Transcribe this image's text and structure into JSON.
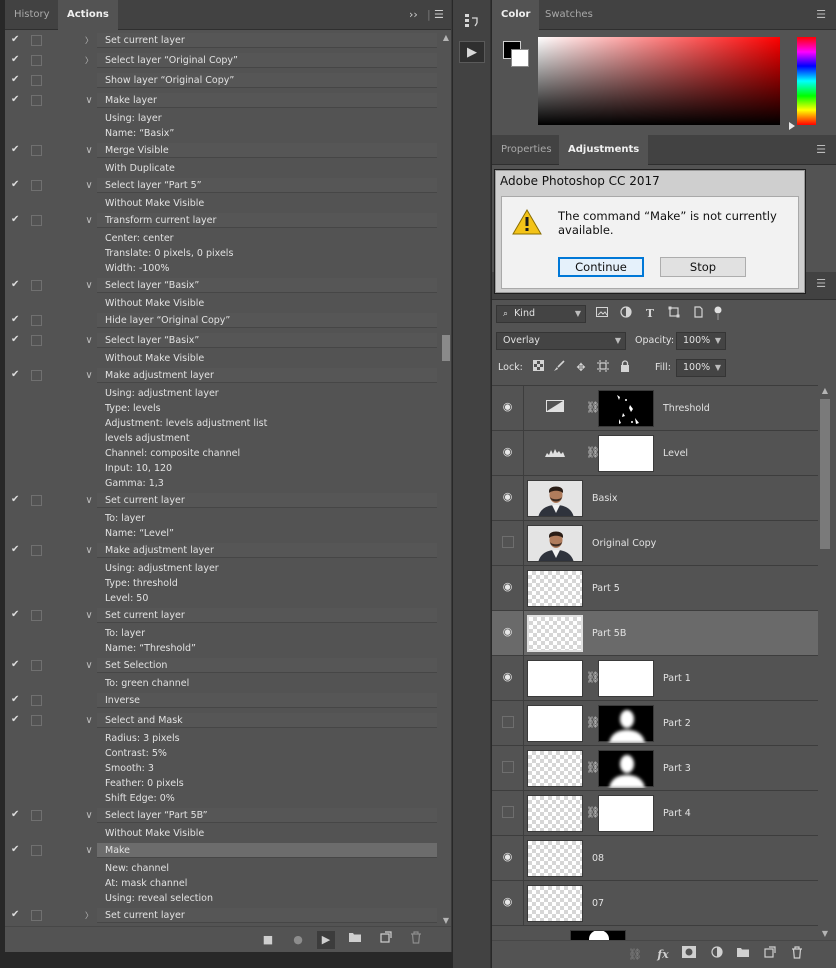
{
  "actions_panel": {
    "tabs": [
      "History",
      "Actions"
    ],
    "active_tab": "Actions",
    "rows": [
      {
        "check": true,
        "twist": "closed",
        "text": "Set current layer",
        "head": true
      },
      {
        "check": true,
        "twist": "closed",
        "text": "Select layer “Original Copy”",
        "head": true
      },
      {
        "check": true,
        "twist": "",
        "text": "Show layer “Original Copy”",
        "head": true
      },
      {
        "check": true,
        "twist": "open",
        "text": "Make layer",
        "head": true
      },
      {
        "check": false,
        "twist": "",
        "text": "Using: layer",
        "head": false
      },
      {
        "check": false,
        "twist": "",
        "text": "Name:  “Basix”",
        "head": false
      },
      {
        "check": true,
        "twist": "open",
        "text": "Merge Visible",
        "head": true
      },
      {
        "check": false,
        "twist": "",
        "text": "With Duplicate",
        "head": false
      },
      {
        "check": true,
        "twist": "open",
        "text": "Select layer “Part 5”",
        "head": true
      },
      {
        "check": false,
        "twist": "",
        "text": "Without Make Visible",
        "head": false
      },
      {
        "check": true,
        "twist": "open",
        "text": "Transform current layer",
        "head": true
      },
      {
        "check": false,
        "twist": "",
        "text": "Center: center",
        "head": false
      },
      {
        "check": false,
        "twist": "",
        "text": "Translate: 0 pixels, 0 pixels",
        "head": false
      },
      {
        "check": false,
        "twist": "",
        "text": "Width: -100%",
        "head": false
      },
      {
        "check": true,
        "twist": "open",
        "text": "Select layer “Basix”",
        "head": true
      },
      {
        "check": false,
        "twist": "",
        "text": "Without Make Visible",
        "head": false
      },
      {
        "check": true,
        "twist": "",
        "text": "Hide layer “Original Copy”",
        "head": true
      },
      {
        "check": true,
        "twist": "open",
        "text": "Select layer “Basix”",
        "head": true
      },
      {
        "check": false,
        "twist": "",
        "text": "Without Make Visible",
        "head": false
      },
      {
        "check": true,
        "twist": "open",
        "text": "Make adjustment layer",
        "head": true
      },
      {
        "check": false,
        "twist": "",
        "text": "Using: adjustment layer",
        "head": false
      },
      {
        "check": false,
        "twist": "",
        "text": "Type: levels",
        "head": false
      },
      {
        "check": false,
        "twist": "",
        "text": "Adjustment: levels adjustment list",
        "head": false
      },
      {
        "check": false,
        "twist": "",
        "text": "levels adjustment",
        "head": false
      },
      {
        "check": false,
        "twist": "",
        "text": "Channel: composite channel",
        "head": false
      },
      {
        "check": false,
        "twist": "",
        "text": "Input: 10, 120",
        "head": false
      },
      {
        "check": false,
        "twist": "",
        "text": "Gamma: 1,3",
        "head": false
      },
      {
        "check": true,
        "twist": "open",
        "text": "Set current layer",
        "head": true
      },
      {
        "check": false,
        "twist": "",
        "text": "To: layer",
        "head": false
      },
      {
        "check": false,
        "twist": "",
        "text": "Name:  “Level”",
        "head": false
      },
      {
        "check": true,
        "twist": "open",
        "text": "Make adjustment layer",
        "head": true
      },
      {
        "check": false,
        "twist": "",
        "text": "Using: adjustment layer",
        "head": false
      },
      {
        "check": false,
        "twist": "",
        "text": "Type: threshold",
        "head": false
      },
      {
        "check": false,
        "twist": "",
        "text": "Level: 50",
        "head": false
      },
      {
        "check": true,
        "twist": "open",
        "text": "Set current layer",
        "head": true
      },
      {
        "check": false,
        "twist": "",
        "text": "To: layer",
        "head": false
      },
      {
        "check": false,
        "twist": "",
        "text": "Name:  “Threshold”",
        "head": false
      },
      {
        "check": true,
        "twist": "open",
        "text": "Set Selection",
        "head": true
      },
      {
        "check": false,
        "twist": "",
        "text": "To: green channel",
        "head": false
      },
      {
        "check": true,
        "twist": "",
        "text": "Inverse",
        "head": true
      },
      {
        "check": true,
        "twist": "open",
        "text": "Select and Mask",
        "head": true
      },
      {
        "check": false,
        "twist": "",
        "text": "Radius: 3 pixels",
        "head": false
      },
      {
        "check": false,
        "twist": "",
        "text": "Contrast: 5%",
        "head": false
      },
      {
        "check": false,
        "twist": "",
        "text": "Smooth: 3",
        "head": false
      },
      {
        "check": false,
        "twist": "",
        "text": "Feather: 0 pixels",
        "head": false
      },
      {
        "check": false,
        "twist": "",
        "text": "Shift Edge: 0%",
        "head": false
      },
      {
        "check": true,
        "twist": "open",
        "text": "Select layer “Part 5B”",
        "head": true
      },
      {
        "check": false,
        "twist": "",
        "text": "Without Make Visible",
        "head": false
      },
      {
        "check": true,
        "twist": "open",
        "text": "Make",
        "head": true,
        "selected": true
      },
      {
        "check": false,
        "twist": "",
        "text": "New: channel",
        "head": false
      },
      {
        "check": false,
        "twist": "",
        "text": "At: mask channel",
        "head": false
      },
      {
        "check": false,
        "twist": "",
        "text": "Using: reveal selection",
        "head": false
      },
      {
        "check": true,
        "twist": "closed",
        "text": "Set current layer",
        "head": true
      }
    ]
  },
  "color_panel": {
    "tabs": [
      "Color",
      "Swatches"
    ],
    "active_tab": "Color"
  },
  "adjustments_panel": {
    "tabs": [
      "Properties",
      "Adjustments"
    ],
    "active_tab": "Adjustments"
  },
  "dialog": {
    "title": "Adobe Photoshop CC 2017",
    "message": "The command “Make” is not currently available.",
    "continue_label": "Continue",
    "stop_label": "Stop"
  },
  "layers_panel": {
    "filter_label": "Kind",
    "blend_mode": "Overlay",
    "opacity_label": "Opacity:",
    "opacity_value": "100%",
    "lock_label": "Lock:",
    "fill_label": "Fill:",
    "fill_value": "100%",
    "layers": [
      {
        "name": "Threshold",
        "visible": true,
        "thumb": "adj-threshold",
        "mask": "threshold"
      },
      {
        "name": "Level",
        "visible": true,
        "thumb": "adj-levels",
        "mask": "white"
      },
      {
        "name": "Basix",
        "visible": true,
        "thumb": "photo",
        "mask": ""
      },
      {
        "name": "Original Copy",
        "visible": false,
        "thumb": "photo",
        "mask": ""
      },
      {
        "name": "Part 5",
        "visible": true,
        "thumb": "checker",
        "mask": ""
      },
      {
        "name": "Part 5B",
        "visible": true,
        "thumb": "checker",
        "mask": "",
        "selected": true
      },
      {
        "name": "Part 1",
        "visible": true,
        "thumb": "white",
        "mask": "white"
      },
      {
        "name": "Part 2",
        "visible": false,
        "thumb": "white",
        "mask": "silhouette"
      },
      {
        "name": "Part 3",
        "visible": false,
        "thumb": "checker",
        "mask": "silhouette"
      },
      {
        "name": "Part 4",
        "visible": false,
        "thumb": "checker",
        "mask": "white"
      },
      {
        "name": "08",
        "visible": true,
        "thumb": "checker",
        "mask": ""
      },
      {
        "name": "07",
        "visible": true,
        "thumb": "checker",
        "mask": ""
      }
    ]
  }
}
